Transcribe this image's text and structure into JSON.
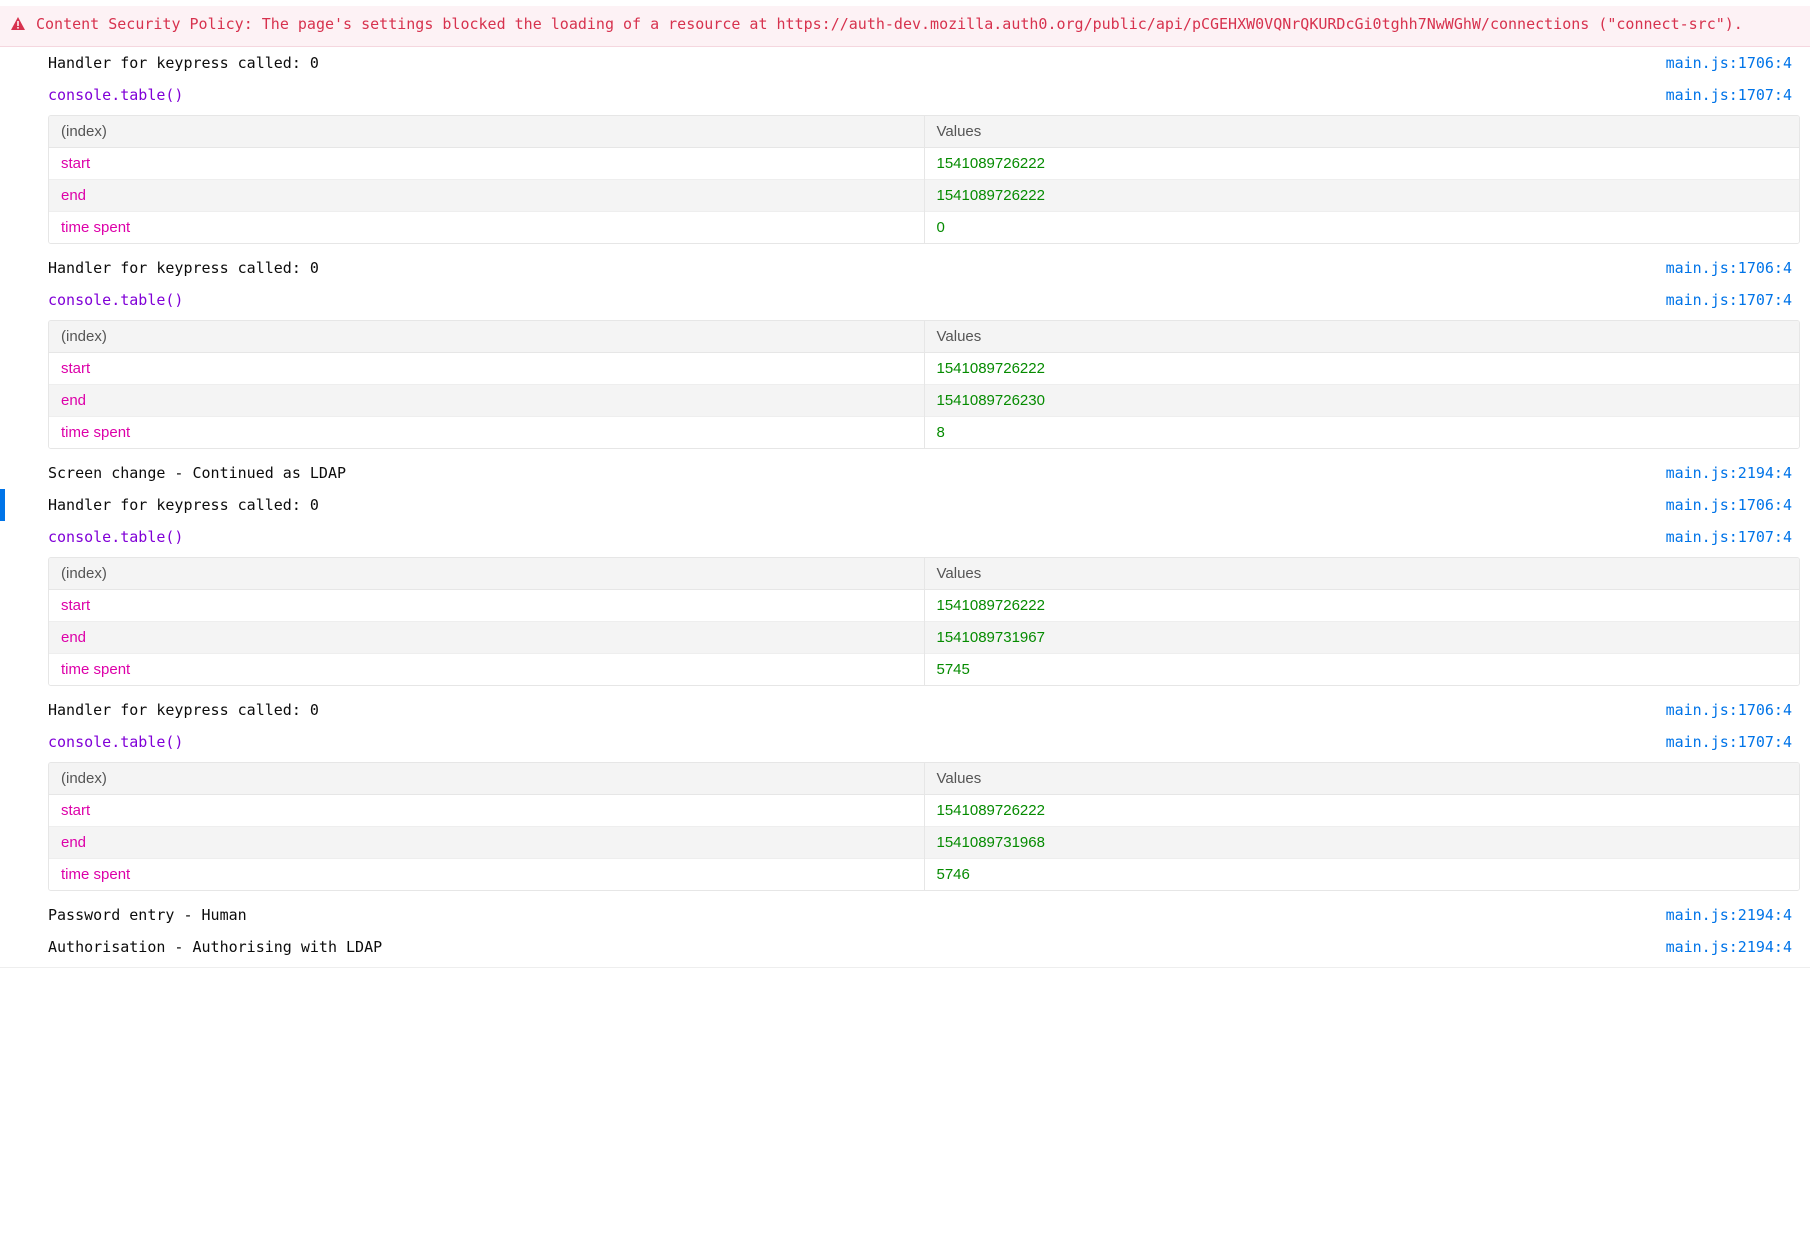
{
  "error": {
    "text": "Content Security Policy: The page's settings blocked the loading of a resource at https://auth-dev.mozilla.auth0.org/public/api/pCGEHXW0VQNrQKURDcGi0tghh7NwWGhW/connections (\"connect-src\")."
  },
  "columns": {
    "index": "(index)",
    "values": "Values"
  },
  "rowLabels": {
    "start": "start",
    "end": "end",
    "timeSpent": "time spent"
  },
  "blocks": [
    {
      "type": "log",
      "msg": "Handler for keypress called: 0",
      "loc": "main.js:1706:4",
      "selected": false,
      "cls": "black"
    },
    {
      "type": "log",
      "msg": "console.table()",
      "loc": "main.js:1707:4",
      "selected": false,
      "cls": "purple"
    },
    {
      "type": "table",
      "start": "1541089726222",
      "end": "1541089726222",
      "timeSpent": "0"
    },
    {
      "type": "log",
      "msg": "Handler for keypress called: 0",
      "loc": "main.js:1706:4",
      "selected": false,
      "cls": "black"
    },
    {
      "type": "log",
      "msg": "console.table()",
      "loc": "main.js:1707:4",
      "selected": false,
      "cls": "purple"
    },
    {
      "type": "table",
      "start": "1541089726222",
      "end": "1541089726230",
      "timeSpent": "8"
    },
    {
      "type": "log",
      "msg": "Screen change - Continued as LDAP",
      "loc": "main.js:2194:4",
      "selected": false,
      "cls": "black"
    },
    {
      "type": "log",
      "msg": "Handler for keypress called: 0",
      "loc": "main.js:1706:4",
      "selected": true,
      "cls": "black"
    },
    {
      "type": "log",
      "msg": "console.table()",
      "loc": "main.js:1707:4",
      "selected": false,
      "cls": "purple"
    },
    {
      "type": "table",
      "start": "1541089726222",
      "end": "1541089731967",
      "timeSpent": "5745"
    },
    {
      "type": "log",
      "msg": "Handler for keypress called: 0",
      "loc": "main.js:1706:4",
      "selected": false,
      "cls": "black"
    },
    {
      "type": "log",
      "msg": "console.table()",
      "loc": "main.js:1707:4",
      "selected": false,
      "cls": "purple"
    },
    {
      "type": "table",
      "start": "1541089726222",
      "end": "1541089731968",
      "timeSpent": "5746"
    },
    {
      "type": "log",
      "msg": "Password entry - Human",
      "loc": "main.js:2194:4",
      "selected": false,
      "cls": "black"
    },
    {
      "type": "log",
      "msg": "Authorisation - Authorising with LDAP",
      "loc": "main.js:2194:4",
      "selected": false,
      "cls": "black"
    }
  ]
}
